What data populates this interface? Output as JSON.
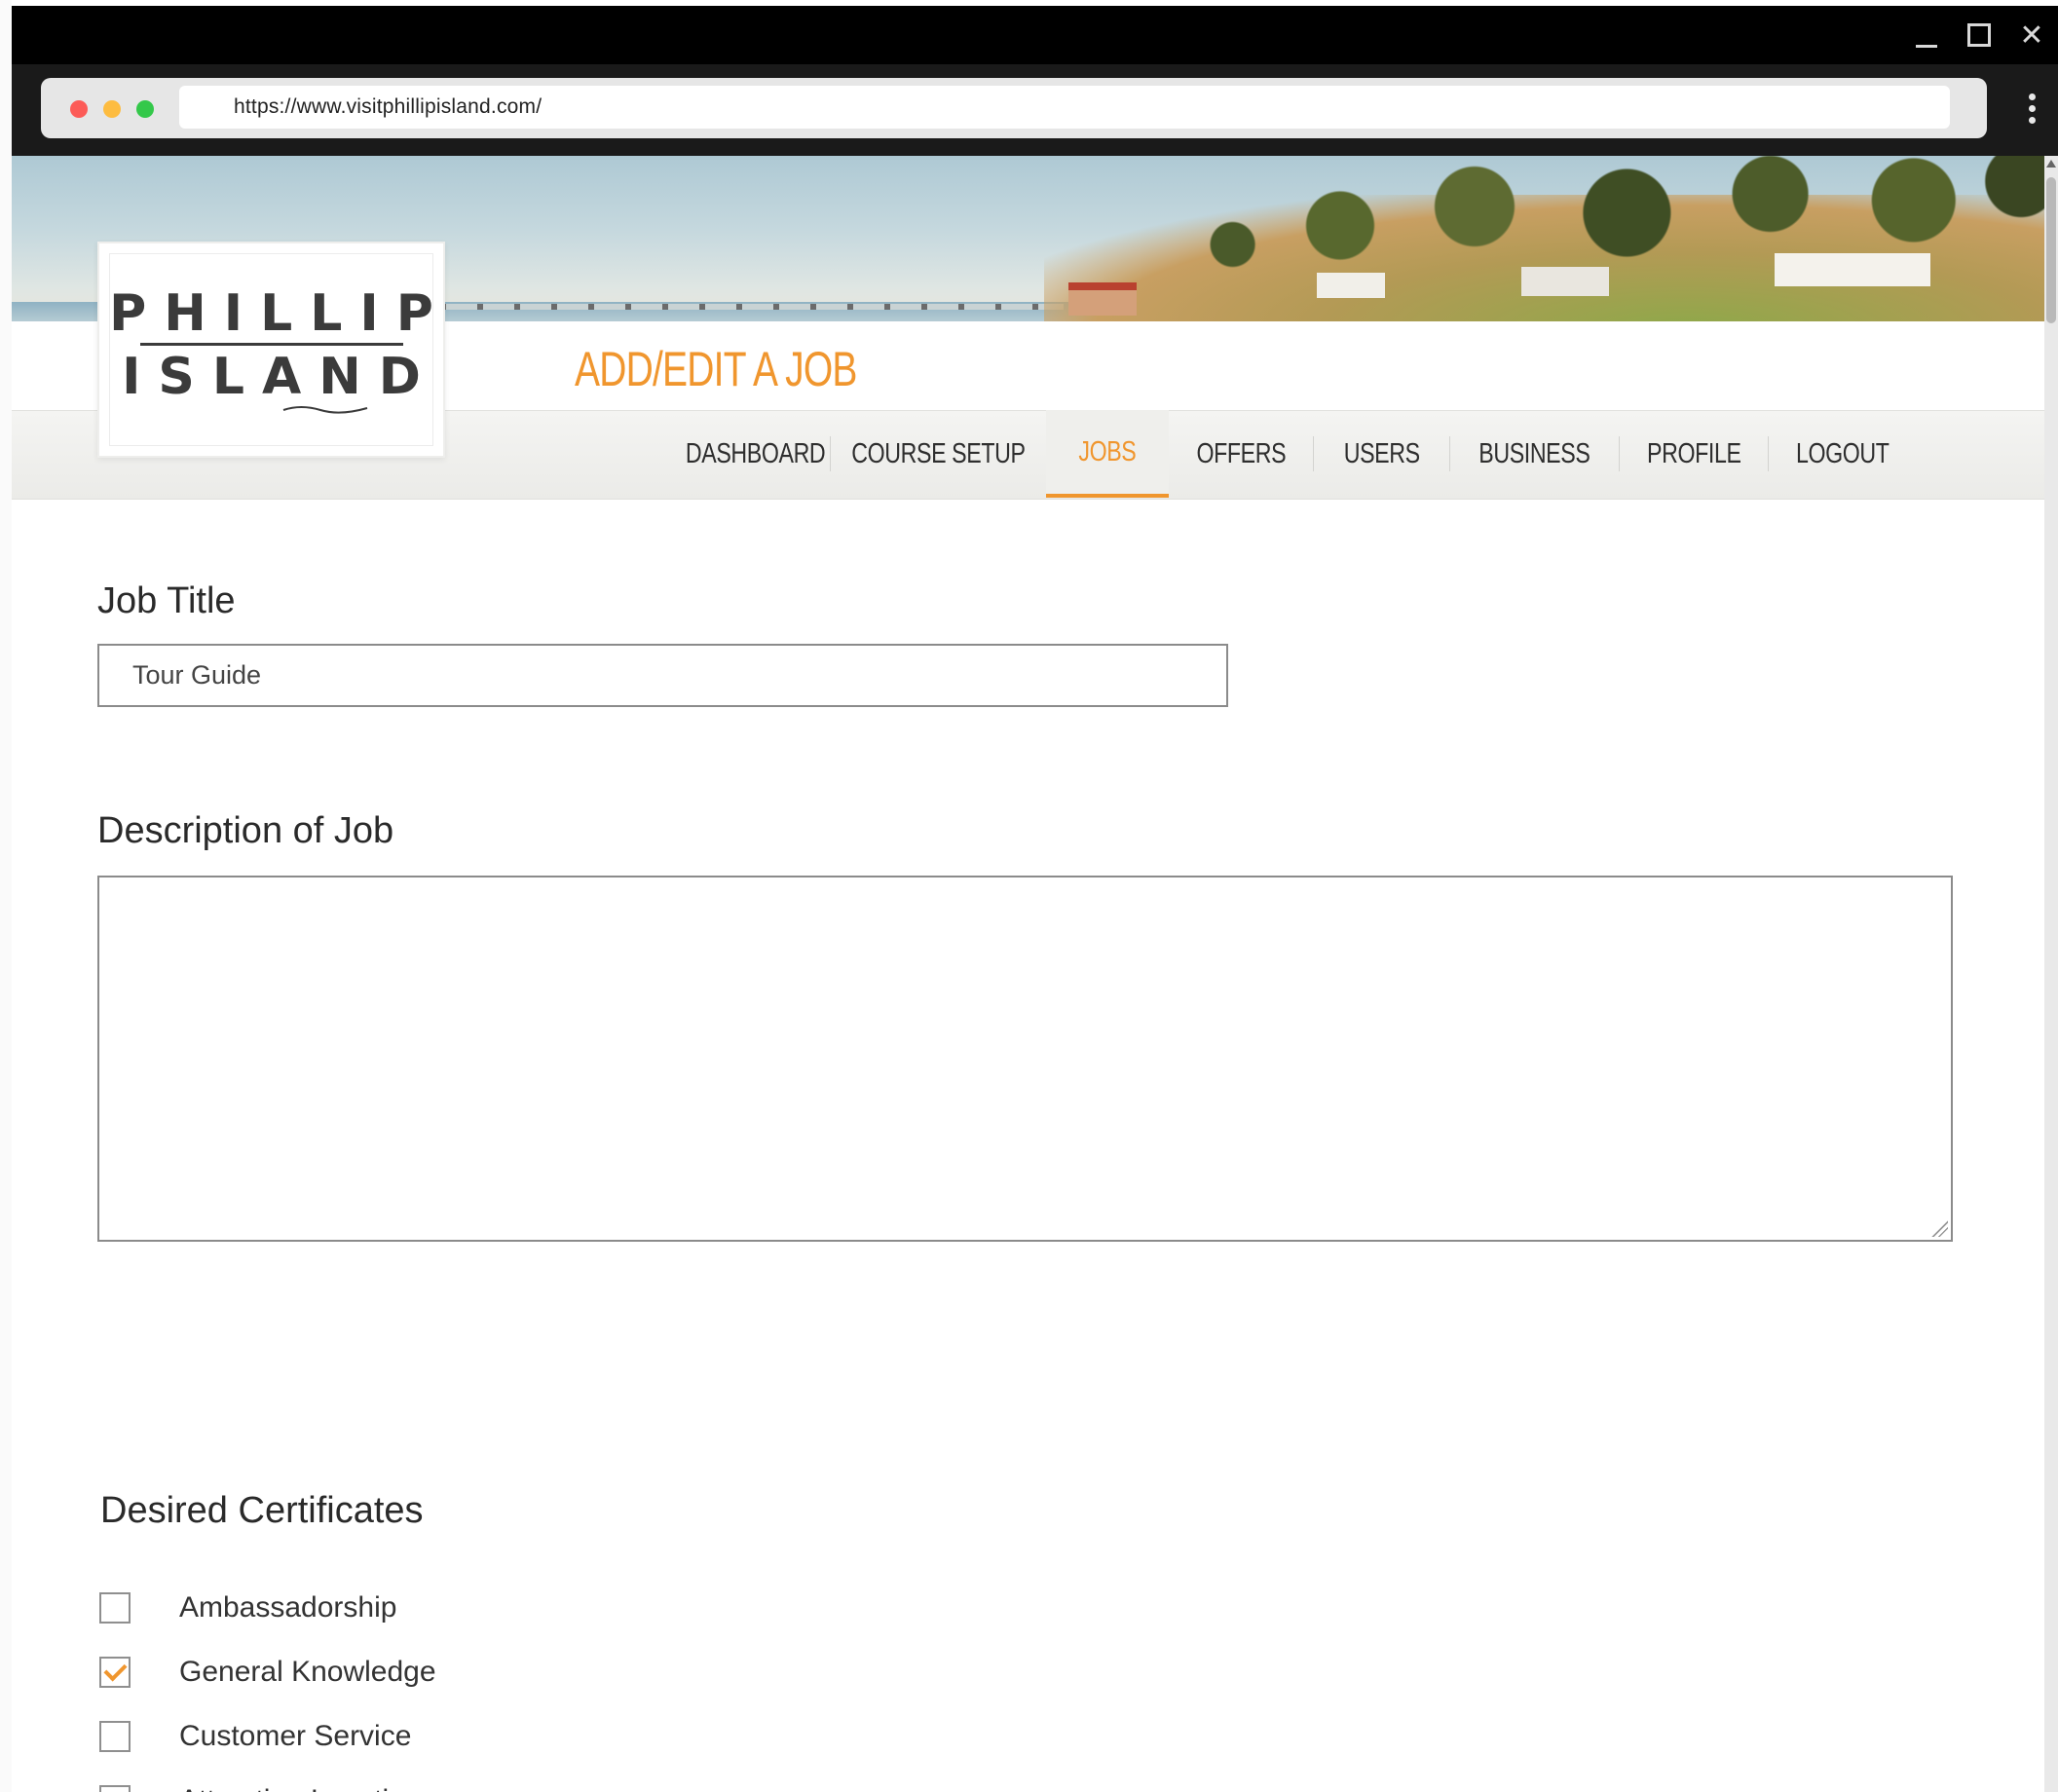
{
  "browser": {
    "url": "https://www.visitphillipisland.com/"
  },
  "logo": {
    "line1": "PHILLIP",
    "line2": "ISLAND"
  },
  "header": {
    "page_title": "ADD/EDIT A JOB"
  },
  "nav": {
    "items": [
      {
        "label": "DASHBOARD",
        "active": false
      },
      {
        "label": "COURSE SETUP",
        "active": false
      },
      {
        "label": "JOBS",
        "active": true
      },
      {
        "label": "OFFERS",
        "active": false
      },
      {
        "label": "USERS",
        "active": false
      },
      {
        "label": "BUSINESS",
        "active": false
      },
      {
        "label": "PROFILE",
        "active": false
      },
      {
        "label": "LOGOUT",
        "active": false
      }
    ]
  },
  "form": {
    "job_title_label": "Job Title",
    "job_title_value": "Tour Guide",
    "description_label": "Description of Job",
    "description_value": "",
    "certificates_label": "Desired Certificates",
    "certificates": [
      {
        "label": "Ambassadorship",
        "checked": false
      },
      {
        "label": "General Knowledge",
        "checked": true
      },
      {
        "label": "Customer Service",
        "checked": false
      },
      {
        "label": "Attraction Location",
        "checked": true
      }
    ]
  },
  "colors": {
    "accent": "#f0962e",
    "title_bar": "#000000",
    "text": "#2a2a2a"
  }
}
